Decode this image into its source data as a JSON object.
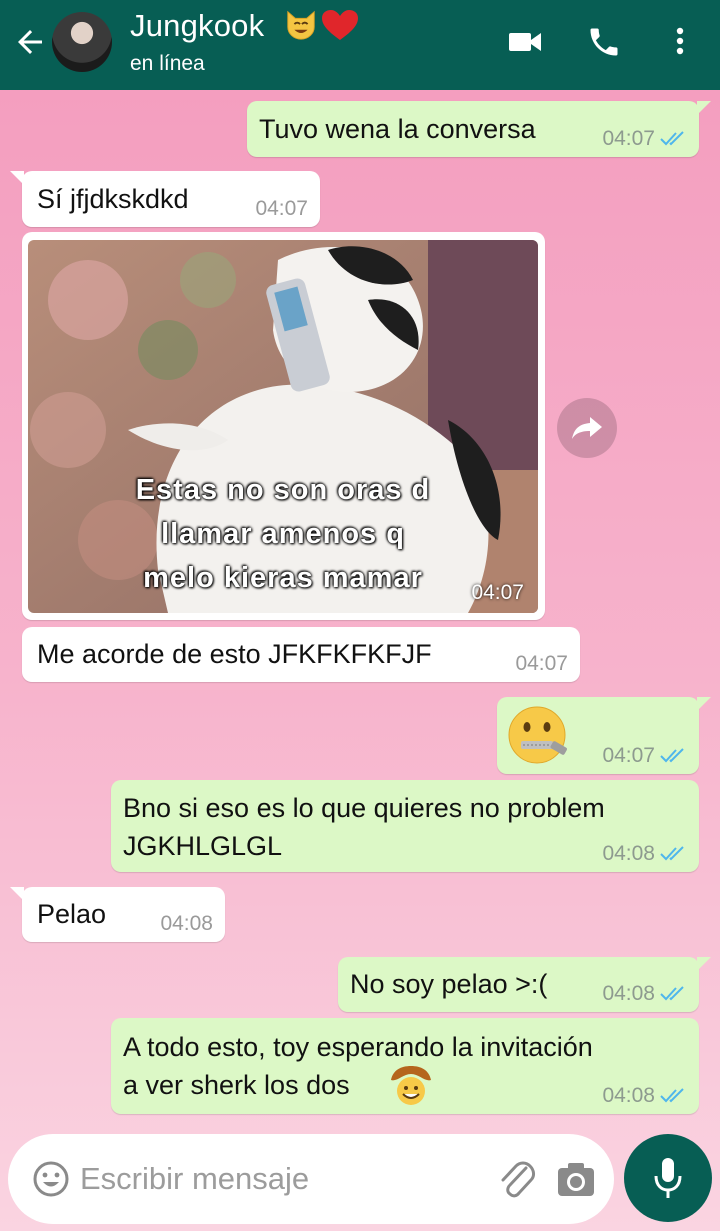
{
  "header": {
    "contact_name": "Jungkook",
    "status": "en línea",
    "name_emojis": [
      "cat-face-emoji",
      "red-heart-emoji"
    ],
    "icons": [
      "back-arrow-icon",
      "video-call-icon",
      "phone-icon",
      "more-options-icon"
    ],
    "color": "#075e54"
  },
  "messages": [
    {
      "direction": "outgoing",
      "text": "Tuvo wena la conversa",
      "time": "04:07",
      "read": true
    },
    {
      "direction": "incoming",
      "text": "Sí jfjdkskdkd",
      "time": "04:07"
    },
    {
      "direction": "incoming",
      "type": "image",
      "caption": "Estas no son oras d\nllamar amenos q\nmelo kieras mamar",
      "time": "04:07"
    },
    {
      "direction": "incoming",
      "text": "Me acorde de esto JFKFKFKFJF",
      "time": "04:07"
    },
    {
      "direction": "outgoing",
      "type": "emoji",
      "emoji": "zipper-mouth-face-emoji",
      "time": "04:07",
      "read": true
    },
    {
      "direction": "outgoing",
      "text": "Bno si eso es lo que quieres no problem\nJGKHLGLGL",
      "time": "04:08",
      "read": true
    },
    {
      "direction": "incoming",
      "text": "Pelao",
      "time": "04:08"
    },
    {
      "direction": "outgoing",
      "text": "No soy pelao >:(",
      "time": "04:08",
      "read": true
    },
    {
      "direction": "outgoing",
      "text": "A todo esto, toy esperando la invitación\na ver sherk los dos",
      "time": "04:08",
      "read": true,
      "trailing_emoji": "cowboy-face-emoji"
    }
  ],
  "composer": {
    "placeholder": "Escribir mensaje",
    "icons": [
      "emoji-icon",
      "attach-icon",
      "camera-icon",
      "mic-icon"
    ]
  },
  "colors": {
    "outgoing_bubble": "#dcf8c6",
    "incoming_bubble": "#ffffff",
    "read_ticks": "#4fb6ec"
  }
}
